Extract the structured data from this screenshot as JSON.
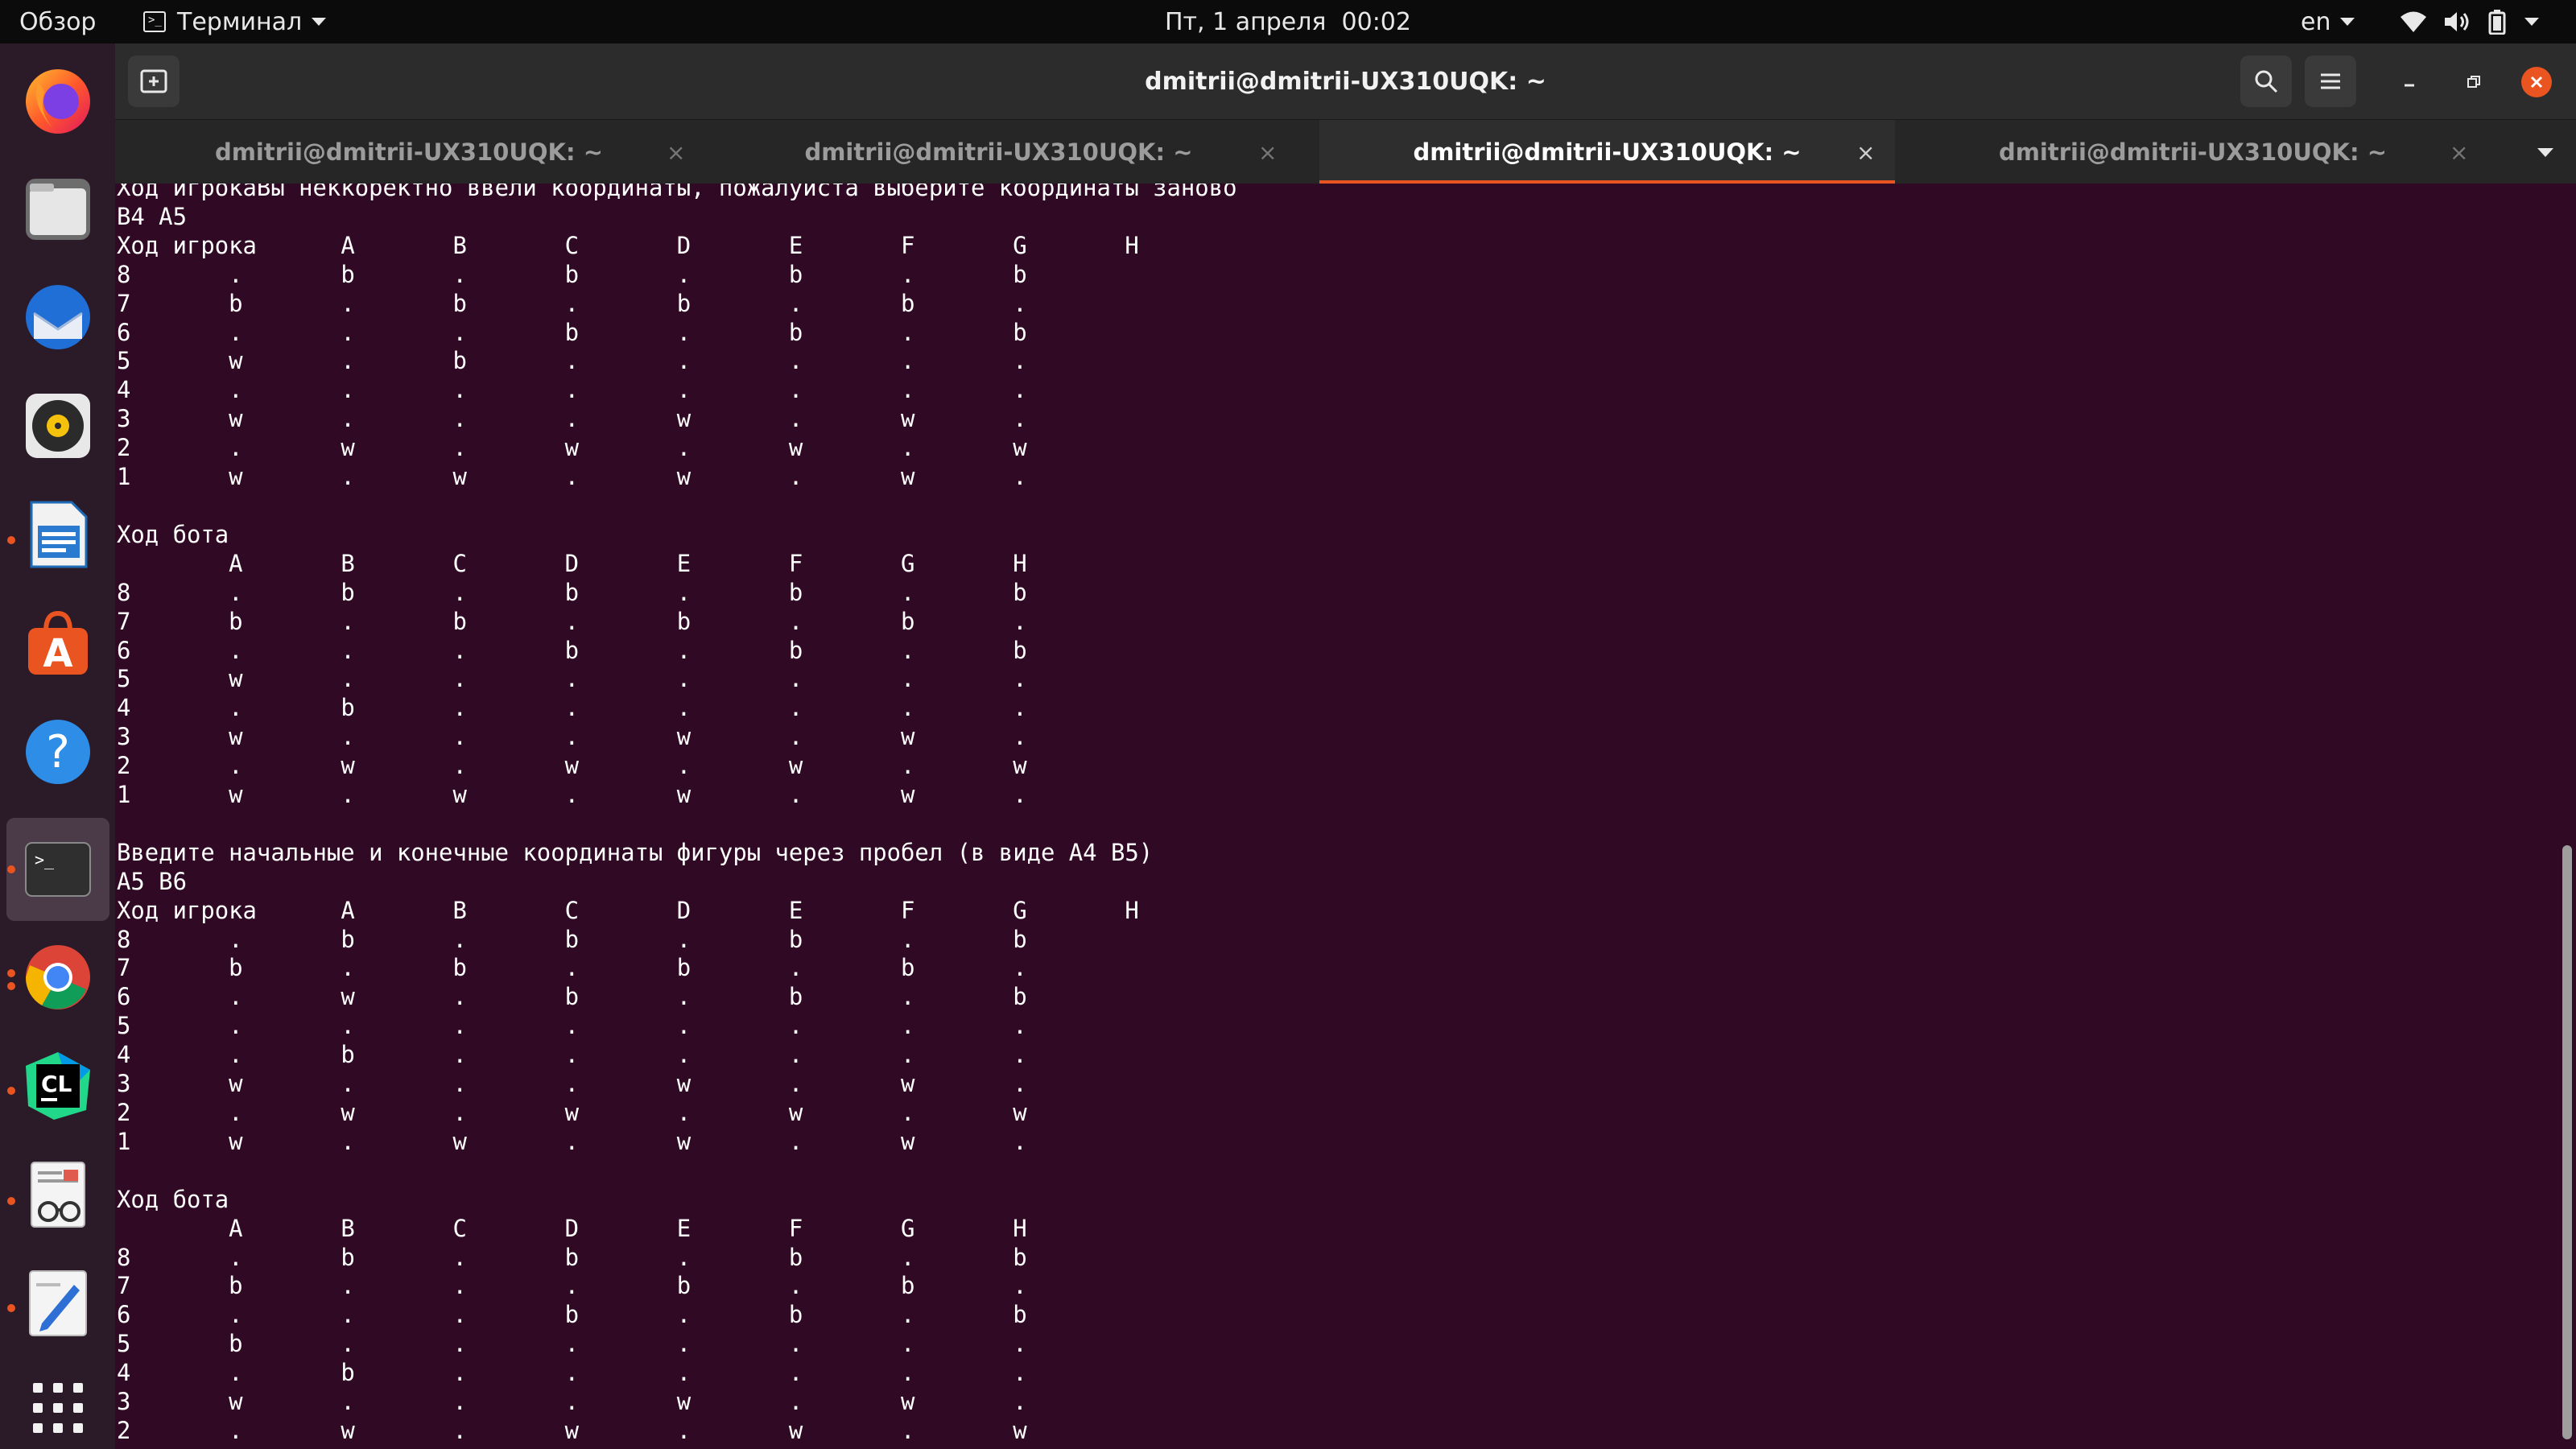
{
  "topbar": {
    "activities": "Обзор",
    "app_menu": "Терминал",
    "clock": "Пт, 1 апреля  00:02",
    "keyboard_layout": "en",
    "icons": [
      "wifi-icon",
      "volume-icon",
      "battery-icon",
      "chevron-down-icon"
    ]
  },
  "dock": {
    "apps": [
      {
        "name": "firefox",
        "running": false
      },
      {
        "name": "files",
        "running": false
      },
      {
        "name": "thunderbird",
        "running": false
      },
      {
        "name": "rhythmbox",
        "running": false
      },
      {
        "name": "libreoffice-writer",
        "running": true
      },
      {
        "name": "ubuntu-software",
        "running": false
      },
      {
        "name": "help",
        "running": false
      },
      {
        "name": "terminal",
        "running": true,
        "active": true
      },
      {
        "name": "chrome",
        "running": true
      },
      {
        "name": "clion",
        "running": true
      },
      {
        "name": "document-viewer",
        "running": true
      },
      {
        "name": "text-editor",
        "running": true
      },
      {
        "name": "show-applications",
        "running": false
      }
    ]
  },
  "window": {
    "title": "dmitrii@dmitrii-UX310UQK: ~",
    "tabs": [
      {
        "label": "dmitrii@dmitrii-UX310UQK: ~",
        "active": false
      },
      {
        "label": "dmitrii@dmitrii-UX310UQK: ~",
        "active": false
      },
      {
        "label": "dmitrii@dmitrii-UX310UQK: ~",
        "active": true
      },
      {
        "label": "dmitrii@dmitrii-UX310UQK: ~",
        "active": false
      }
    ],
    "tab_close_glyph": "×"
  },
  "colors": {
    "terminal_bg": "#300a24",
    "accent": "#e95420",
    "text": "#ffffff"
  },
  "terminal": {
    "lines": [
      "Ход игрокаВы неккоректно ввели координаты, пожалуйста выберите координаты заново",
      "B4 A5",
      "Ход игрока\tA\tB\tC\tD\tE\tF\tG\tH",
      "8\t.\tb\t.\tb\t.\tb\t.\tb",
      "7\tb\t.\tb\t.\tb\t.\tb\t.",
      "6\t.\t.\t.\tb\t.\tb\t.\tb",
      "5\tw\t.\tb\t.\t.\t.\t.\t.",
      "4\t.\t.\t.\t.\t.\t.\t.\t.",
      "3\tw\t.\t.\t.\tw\t.\tw\t.",
      "2\t.\tw\t.\tw\t.\tw\t.\tw",
      "1\tw\t.\tw\t.\tw\t.\tw\t.",
      "",
      "Ход бота",
      "\tA\tB\tC\tD\tE\tF\tG\tH",
      "8\t.\tb\t.\tb\t.\tb\t.\tb",
      "7\tb\t.\tb\t.\tb\t.\tb\t.",
      "6\t.\t.\t.\tb\t.\tb\t.\tb",
      "5\tw\t.\t.\t.\t.\t.\t.\t.",
      "4\t.\tb\t.\t.\t.\t.\t.\t.",
      "3\tw\t.\t.\t.\tw\t.\tw\t.",
      "2\t.\tw\t.\tw\t.\tw\t.\tw",
      "1\tw\t.\tw\t.\tw\t.\tw\t.",
      "",
      "Введите начальные и конечные координаты фигуры через пробел (в виде A4 B5)",
      "A5 B6",
      "Ход игрока\tA\tB\tC\tD\tE\tF\tG\tH",
      "8\t.\tb\t.\tb\t.\tb\t.\tb",
      "7\tb\t.\tb\t.\tb\t.\tb\t.",
      "6\t.\tw\t.\tb\t.\tb\t.\tb",
      "5\t.\t.\t.\t.\t.\t.\t.\t.",
      "4\t.\tb\t.\t.\t.\t.\t.\t.",
      "3\tw\t.\t.\t.\tw\t.\tw\t.",
      "2\t.\tw\t.\tw\t.\tw\t.\tw",
      "1\tw\t.\tw\t.\tw\t.\tw\t.",
      "",
      "Ход бота",
      "\tA\tB\tC\tD\tE\tF\tG\tH",
      "8\t.\tb\t.\tb\t.\tb\t.\tb",
      "7\tb\t.\t.\t.\tb\t.\tb\t.",
      "6\t.\t.\t.\tb\t.\tb\t.\tb",
      "5\tb\t.\t.\t.\t.\t.\t.\t.",
      "4\t.\tb\t.\t.\t.\t.\t.\t.",
      "3\tw\t.\t.\t.\tw\t.\tw\t.",
      "2\t.\tw\t.\tw\t.\tw\t.\tw"
    ]
  }
}
